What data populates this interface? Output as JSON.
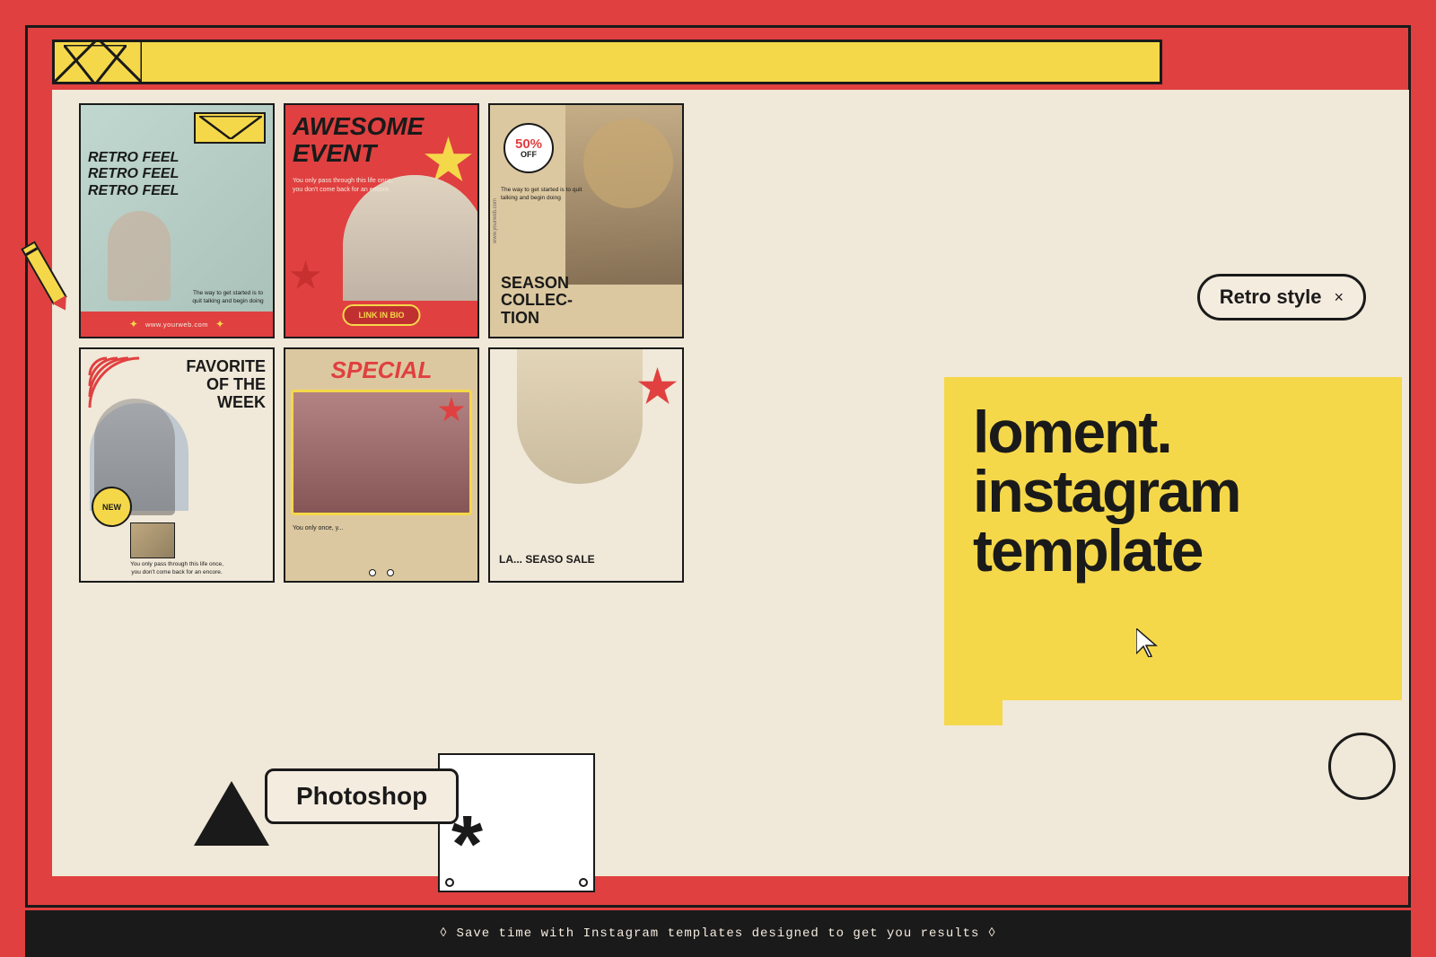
{
  "page": {
    "background_color": "#e04040",
    "title": "loment. instagram template"
  },
  "top_bar": {
    "background": "#f5d84a"
  },
  "retro_style_tag": {
    "label": "Retro style",
    "close": "×"
  },
  "yellow_box": {
    "line1": "loment.",
    "line2": "instagram",
    "line3": "template"
  },
  "photoshop_button": {
    "label": "Photoshop"
  },
  "bottom_bar": {
    "text": "◊  Save time with Instagram templates designed to get you results  ◊"
  },
  "cards": [
    {
      "id": 1,
      "title_line1": "RETRO FEEL",
      "title_line2": "RETRO FEEL",
      "title_line3": "RETRO FEEL",
      "subtitle": "The way to get started is to quit\ntalking and begin doing",
      "website": "www.yourweb.com",
      "bg": "#c8ddd8"
    },
    {
      "id": 2,
      "title_line1": "AWESOME",
      "title_line2": "EVENT",
      "body": "You only pass through this life once, you don't come back for an encore.",
      "cta": "LINK IN BIO",
      "bg": "#e04040"
    },
    {
      "id": 3,
      "discount": "50%",
      "discount_label": "OFF",
      "title": "SEASON\nCOLLEC-\nTION",
      "subtitle": "The way to get started is to quit talking and begin doing",
      "website": "www.yourweb.com",
      "bg": "#dcc8a0"
    },
    {
      "id": 4,
      "title_line1": "FAVORITE",
      "title_line2": "OF THE",
      "title_line3": "WEEK",
      "badge": "NEW",
      "body": "You only pass through this life once, you don't come back for an encore.",
      "bg": "#f0e8d8"
    },
    {
      "id": 5,
      "title": "SPECIAL",
      "body": "You only once, y...",
      "bg": "#dcc8a0"
    },
    {
      "id": 6,
      "sale_text": "LA...\nSEASO\nSALE",
      "bg": "#f0e8d8"
    }
  ]
}
